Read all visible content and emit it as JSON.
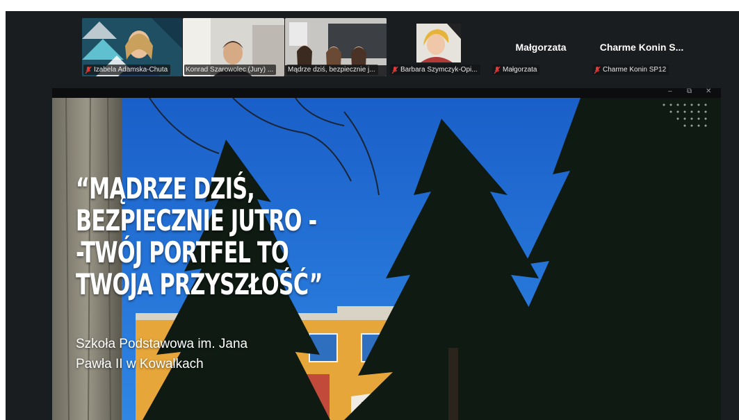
{
  "participants": [
    {
      "name": "Izabela Adamska-Chuta",
      "muted": true
    },
    {
      "name": "Konrad Szarowolec (Jury) ...",
      "muted": false
    },
    {
      "name": "Mądrze dziś, bezpiecznie j...",
      "muted": false,
      "active": true
    },
    {
      "name": "Barbara Szymczyk-Opi...",
      "muted": true
    },
    {
      "name": "Małgorzata",
      "display_name": "Małgorzata",
      "muted": true
    },
    {
      "name": "Charme Konin SP12",
      "display_name": "Charme Konin S...",
      "muted": true
    }
  ],
  "window_controls": {
    "minimize": "–",
    "restore": "⧉",
    "close": "✕"
  },
  "slide": {
    "title": "“MĄDRZE DZIŚ,\nBEZPIECZNIE JUTRO -\n-TWÓJ PORTFEL TO\nTWOJA PRZYSZŁOŚĆ”",
    "subtitle": "Szkoła Podstawowa im. Jana\nPawła II w Kowalkach"
  },
  "colors": {
    "app_bg": "#1a1d20",
    "active_speaker": "#2ddc5a",
    "muted_icon": "#e03b3b",
    "sky": "#1f6fd6"
  }
}
